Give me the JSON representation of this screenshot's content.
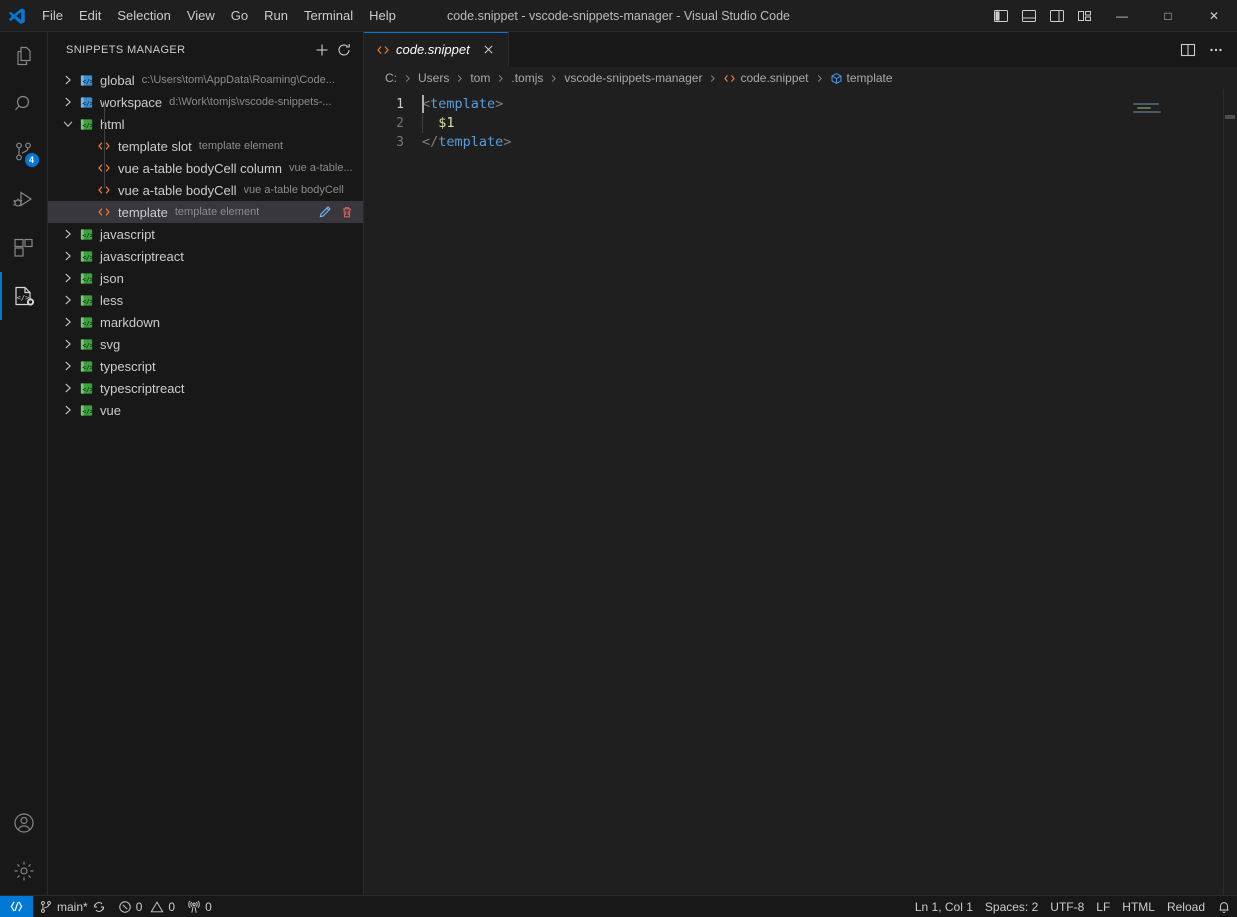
{
  "titlebar": {
    "logo_icon": "vscode-logo-icon",
    "menus": [
      "File",
      "Edit",
      "Selection",
      "View",
      "Go",
      "Run",
      "Terminal",
      "Help"
    ],
    "window_title": "code.snippet - vscode-snippets-manager - Visual Studio Code",
    "layout_buttons": [
      {
        "name": "toggle-primary-sidebar",
        "icon": "primary-sidebar-icon"
      },
      {
        "name": "toggle-panel",
        "icon": "panel-icon"
      },
      {
        "name": "toggle-secondary-sidebar",
        "icon": "secondary-sidebar-icon"
      },
      {
        "name": "customize-layout",
        "icon": "layout-grid-icon"
      }
    ],
    "window_controls": [
      {
        "name": "minimize-button",
        "glyph": "—"
      },
      {
        "name": "maximize-button",
        "glyph": "□"
      },
      {
        "name": "close-button",
        "glyph": "✕"
      }
    ]
  },
  "activitybar": {
    "items": [
      {
        "name": "explorer",
        "icon": "files-icon",
        "active": false,
        "badge": null
      },
      {
        "name": "search",
        "icon": "search-icon",
        "active": false,
        "badge": null
      },
      {
        "name": "source-control",
        "icon": "source-control-icon",
        "active": false,
        "badge": "4"
      },
      {
        "name": "run-and-debug",
        "icon": "debug-icon",
        "active": false,
        "badge": null
      },
      {
        "name": "extensions",
        "icon": "extensions-icon",
        "active": false,
        "badge": null
      },
      {
        "name": "snippets-manager",
        "icon": "snippets-icon",
        "active": true,
        "badge": null
      }
    ],
    "bottom_items": [
      {
        "name": "accounts",
        "icon": "account-icon"
      },
      {
        "name": "manage-settings",
        "icon": "gear-icon"
      }
    ],
    "accent_color": "#0078d4"
  },
  "sidebar": {
    "title": "SNIPPETS MANAGER",
    "actions": [
      {
        "name": "new-snippet-button",
        "icon": "plus-icon"
      },
      {
        "name": "refresh-button",
        "icon": "refresh-icon"
      }
    ],
    "tree": [
      {
        "label": "global",
        "desc": "c:\\Users\\tom\\AppData\\Roaming\\Code...",
        "level": 1,
        "icon": "snippet-folder-icon",
        "expanded": false,
        "selected": false
      },
      {
        "label": "workspace",
        "desc": "d:\\Work\\tomjs\\vscode-snippets-...",
        "level": 1,
        "icon": "snippet-folder-icon",
        "expanded": false,
        "selected": false
      },
      {
        "label": "html",
        "desc": "",
        "level": 1,
        "icon": "snippet-folder-icon",
        "expanded": true,
        "selected": false
      },
      {
        "label": "template slot",
        "desc": "template element",
        "level": 2,
        "icon": "code-tag-icon",
        "expanded": null,
        "selected": false
      },
      {
        "label": "vue a-table bodyCell column",
        "desc": "vue a-table...",
        "level": 2,
        "icon": "code-tag-icon",
        "expanded": null,
        "selected": false
      },
      {
        "label": "vue a-table bodyCell",
        "desc": "vue a-table bodyCell",
        "level": 2,
        "icon": "code-tag-icon",
        "expanded": null,
        "selected": false
      },
      {
        "label": "template",
        "desc": "template element",
        "level": 2,
        "icon": "code-tag-icon",
        "expanded": null,
        "selected": true
      },
      {
        "label": "javascript",
        "desc": "",
        "level": 1,
        "icon": "snippet-folder-icon",
        "expanded": false,
        "selected": false
      },
      {
        "label": "javascriptreact",
        "desc": "",
        "level": 1,
        "icon": "snippet-folder-icon",
        "expanded": false,
        "selected": false
      },
      {
        "label": "json",
        "desc": "",
        "level": 1,
        "icon": "snippet-folder-icon",
        "expanded": false,
        "selected": false
      },
      {
        "label": "less",
        "desc": "",
        "level": 1,
        "icon": "snippet-folder-icon",
        "expanded": false,
        "selected": false
      },
      {
        "label": "markdown",
        "desc": "",
        "level": 1,
        "icon": "snippet-folder-icon",
        "expanded": false,
        "selected": false
      },
      {
        "label": "svg",
        "desc": "",
        "level": 1,
        "icon": "snippet-folder-icon",
        "expanded": false,
        "selected": false
      },
      {
        "label": "typescript",
        "desc": "",
        "level": 1,
        "icon": "snippet-folder-icon",
        "expanded": false,
        "selected": false
      },
      {
        "label": "typescriptreact",
        "desc": "",
        "level": 1,
        "icon": "snippet-folder-icon",
        "expanded": false,
        "selected": false
      },
      {
        "label": "vue",
        "desc": "",
        "level": 1,
        "icon": "snippet-folder-icon",
        "expanded": false,
        "selected": false
      }
    ],
    "row_actions": [
      {
        "name": "edit-snippet-button",
        "icon": "pencil-icon"
      },
      {
        "name": "delete-snippet-button",
        "icon": "trash-icon"
      }
    ]
  },
  "editor": {
    "tab": {
      "label": "code.snippet",
      "icon": "code-tag-icon",
      "close_icon": "close-icon",
      "dirty": false
    },
    "tab_actions": [
      {
        "name": "split-editor-right-button",
        "icon": "split-editor-icon"
      },
      {
        "name": "more-actions-button",
        "icon": "ellipsis-icon"
      }
    ],
    "breadcrumbs": [
      {
        "label": "C:",
        "icon": null
      },
      {
        "label": "Users",
        "icon": null
      },
      {
        "label": "tom",
        "icon": null
      },
      {
        "label": ".tomjs",
        "icon": null
      },
      {
        "label": "vscode-snippets-manager",
        "icon": null
      },
      {
        "label": "code.snippet",
        "icon": "code-tag-icon"
      },
      {
        "label": "template",
        "icon": "symbol-cube-icon"
      }
    ],
    "line_numbers": [
      "1",
      "2",
      "3"
    ],
    "active_line": 1,
    "code_lines": [
      [
        {
          "t": "<",
          "c": "punct"
        },
        {
          "t": "template",
          "c": "tag"
        },
        {
          "t": ">",
          "c": "punct"
        }
      ],
      [
        {
          "t": "  ",
          "c": "plain"
        },
        {
          "t": "$1",
          "c": "var"
        }
      ],
      [
        {
          "t": "</",
          "c": "punct"
        },
        {
          "t": "template",
          "c": "tag"
        },
        {
          "t": ">",
          "c": "punct"
        }
      ]
    ],
    "colors": {
      "tag": "#569cd6",
      "punct": "#808080",
      "variable": "#dcdcaa",
      "background": "#1f1f1f",
      "line_number": "#6e7681"
    }
  },
  "statusbar": {
    "remote": {
      "name": "remote-indicator",
      "icon": "remote-icon"
    },
    "left_items": [
      {
        "name": "branch-status",
        "icon": "git-branch-icon",
        "label": "main*",
        "sync_icon": "sync-icon"
      },
      {
        "name": "problems-status",
        "icon": "error-icon",
        "label": "0",
        "icon2": "warning-icon",
        "label2": "0"
      },
      {
        "name": "ports-status",
        "icon": "radio-tower-icon",
        "label": "0"
      }
    ],
    "right_items": [
      {
        "name": "cursor-position",
        "label": "Ln 1, Col 1"
      },
      {
        "name": "indentation",
        "label": "Spaces: 2"
      },
      {
        "name": "encoding",
        "label": "UTF-8"
      },
      {
        "name": "eol",
        "label": "LF"
      },
      {
        "name": "language-mode",
        "label": "HTML"
      },
      {
        "name": "reload-action",
        "label": "Reload"
      }
    ],
    "notifications": {
      "name": "notifications-bell",
      "icon": "bell-icon"
    }
  }
}
